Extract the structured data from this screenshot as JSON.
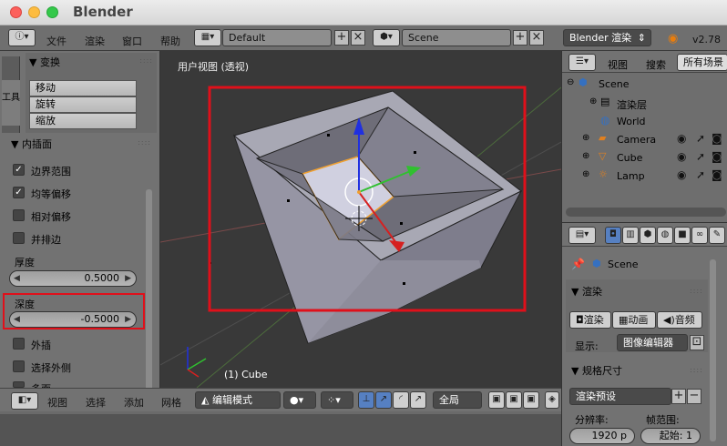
{
  "window": {
    "title": "Blender"
  },
  "info_bar": {
    "menu": [
      "文件",
      "渲染",
      "窗口",
      "帮助"
    ],
    "screen_layout": "Default",
    "scene": "Scene",
    "render_engine": "Blender 渲染",
    "version": "v2.78"
  },
  "tool_shelf": {
    "tab_label": "工具",
    "transform_header": "▼ 变换",
    "transform_buttons": [
      "移动",
      "旋转",
      "缩放"
    ],
    "inset_header": "▼ 内插面",
    "checkboxes": [
      {
        "label": "边界范围",
        "checked": true
      },
      {
        "label": "均等偏移",
        "checked": true
      },
      {
        "label": "相对偏移",
        "checked": false
      },
      {
        "label": "并排边",
        "checked": false
      }
    ],
    "thickness_label": "厚度",
    "thickness_value": "0.5000",
    "depth_label": "深度",
    "depth_value": "-0.5000",
    "checkboxes2": [
      {
        "label": "外插",
        "checked": false
      },
      {
        "label": "选择外侧",
        "checked": false
      },
      {
        "label": "多面",
        "checked": false
      }
    ]
  },
  "viewport": {
    "view_label": "用户视图 (透视)",
    "object_label": "(1) Cube",
    "header": {
      "view": "视图",
      "select": "选择",
      "add": "添加",
      "mesh": "网格",
      "mode": "编辑模式",
      "pivot": "全局"
    }
  },
  "outliner": {
    "view": "视图",
    "search": "搜索",
    "all_scenes": "所有场景",
    "items": [
      "Scene",
      "渲染层",
      "World",
      "Camera",
      "Cube",
      "Lamp"
    ]
  },
  "properties": {
    "scene": "Scene",
    "render_header": "▼ 渲染",
    "render_buttons": [
      "渲染",
      "动画",
      "音频"
    ],
    "display_label": "显示:",
    "display_value": "图像编辑器",
    "dimensions_header": "▼ 规格尺寸",
    "render_presets": "渲染预设",
    "resolution_label": "分辨率:",
    "frame_range_label": "帧范围:",
    "res_x": "1920 p",
    "start_label": "起始:",
    "start_value": "1"
  },
  "colors": {
    "accent_red": "#e0101a",
    "selection_orange": "#f0a030",
    "axis_x": "#d62020",
    "axis_y": "#30c030",
    "axis_z": "#2030e0"
  }
}
